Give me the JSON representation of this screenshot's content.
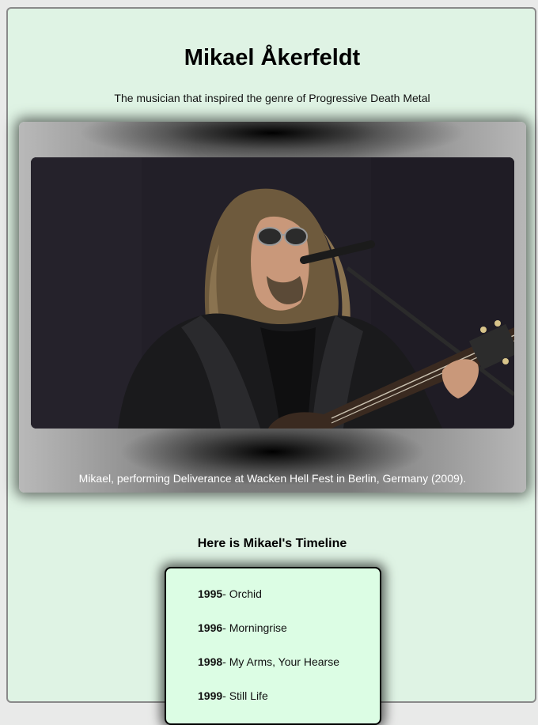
{
  "header": {
    "title": "Mikael Åkerfeldt",
    "subtitle": "The musician that inspired the genre of Progressive Death Metal"
  },
  "photo": {
    "alt": "Mikael Åkerfeldt performing on stage with sunglasses, microphone and guitar",
    "caption": "Mikael, performing Deliverance at Wacken Hell Fest in Berlin, Germany (2009)."
  },
  "timeline": {
    "heading": "Here is Mikael's Timeline",
    "items": [
      {
        "year": "1995",
        "album": "- Orchid"
      },
      {
        "year": "1996",
        "album": "- Morningrise"
      },
      {
        "year": "1998",
        "album": "- My Arms, Your Hearse"
      },
      {
        "year": "1999",
        "album": "- Still Life"
      }
    ]
  }
}
